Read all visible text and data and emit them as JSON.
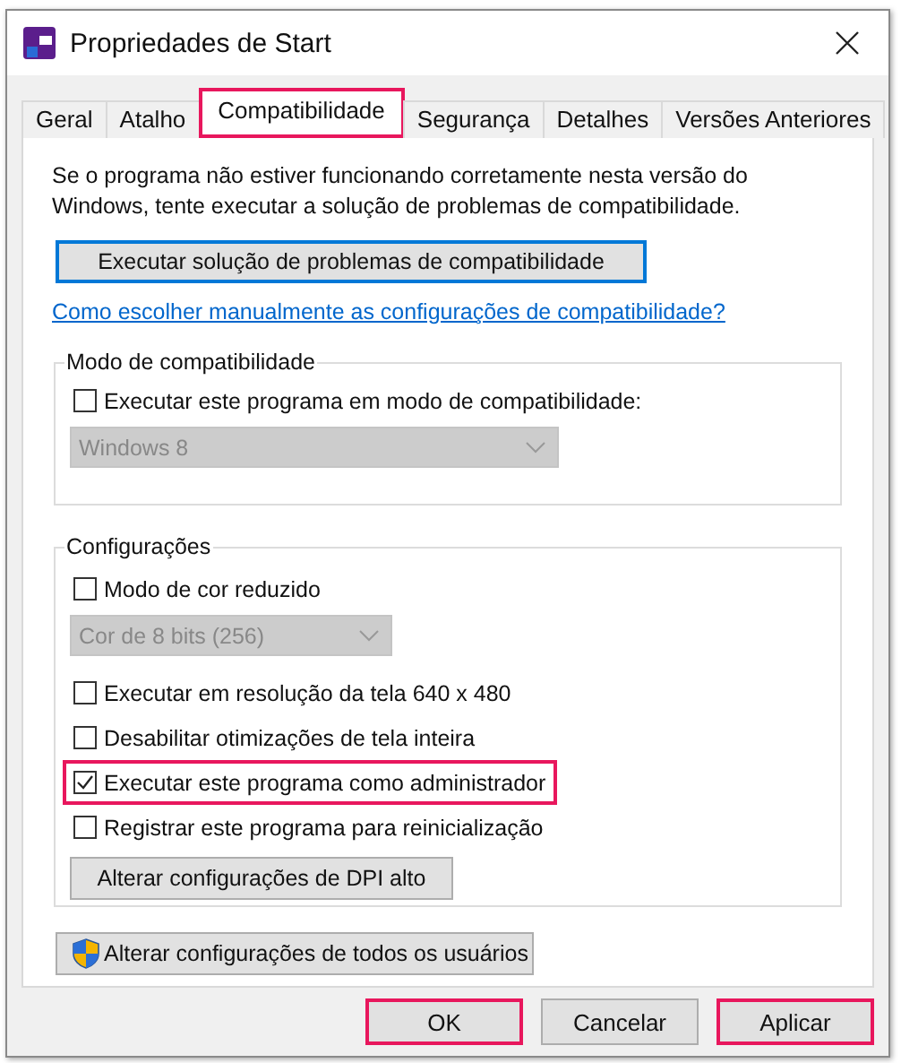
{
  "window": {
    "title": "Propriedades de Start"
  },
  "tabs": [
    {
      "label": "Geral",
      "selected": false,
      "highlighted": false
    },
    {
      "label": "Atalho",
      "selected": false,
      "highlighted": false
    },
    {
      "label": "Compatibilidade",
      "selected": true,
      "highlighted": true
    },
    {
      "label": "Segurança",
      "selected": false,
      "highlighted": false
    },
    {
      "label": "Detalhes",
      "selected": false,
      "highlighted": false
    },
    {
      "label": "Versões Anteriores",
      "selected": false,
      "highlighted": false
    }
  ],
  "description": "Se o programa não estiver funcionando corretamente nesta versão do Windows, tente executar a solução de problemas de compatibilidade.",
  "troubleshoot_button": {
    "label": "Executar solução de problemas de compatibilidade"
  },
  "help_link": "Como escolher manualmente as configurações de compatibilidade?",
  "compatibility_mode": {
    "legend": "Modo de compatibilidade",
    "items": [
      {
        "kind": "checkbox",
        "label": "Executar este programa em modo de compatibilidade:",
        "checked": false,
        "highlighted": false
      },
      {
        "kind": "dropdown",
        "value": "Windows 8",
        "disabled": true
      }
    ]
  },
  "settings": {
    "legend": "Configurações",
    "items": [
      {
        "kind": "checkbox",
        "label": "Modo de cor reduzido",
        "checked": false,
        "highlighted": false
      },
      {
        "kind": "dropdown",
        "value": "Cor de 8 bits (256)",
        "disabled": true
      },
      {
        "kind": "checkbox",
        "label": "Executar em resolução da tela 640 x 480",
        "checked": false,
        "highlighted": false
      },
      {
        "kind": "checkbox",
        "label": "Desabilitar otimizações de tela inteira",
        "checked": false,
        "highlighted": false
      },
      {
        "kind": "checkbox",
        "label": "Executar este programa como administrador",
        "checked": true,
        "highlighted": true
      },
      {
        "kind": "checkbox",
        "label": "Registrar este programa para reinicialização",
        "checked": false,
        "highlighted": false
      },
      {
        "kind": "button",
        "label": "Alterar configurações de DPI alto"
      }
    ]
  },
  "all_users_button": {
    "label": "Alterar configurações de todos os usuários"
  },
  "buttons": [
    {
      "label": "OK",
      "highlighted": true
    },
    {
      "label": "Cancelar",
      "highlighted": false
    },
    {
      "label": "Aplicar",
      "highlighted": true
    }
  ]
}
